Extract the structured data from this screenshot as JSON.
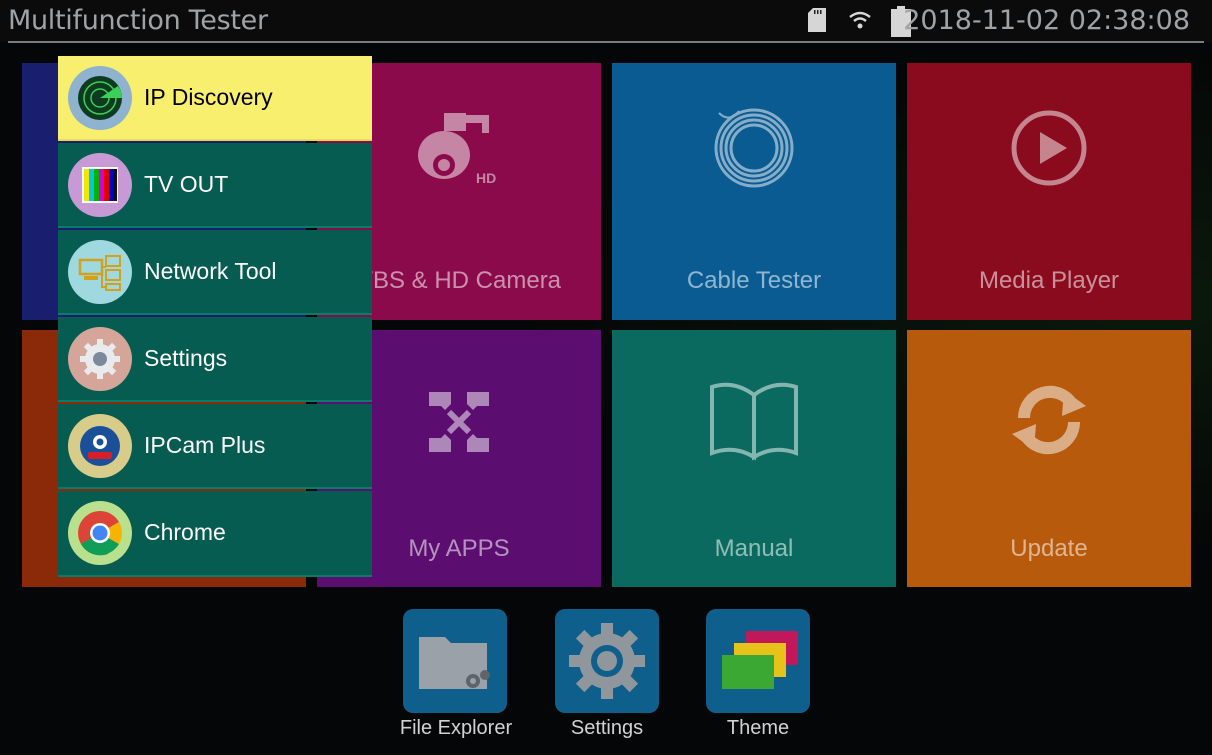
{
  "status_bar": {
    "title": "Multifunction Tester",
    "datetime": "2018-11-02 02:38:08",
    "icons": [
      "sd-card-icon",
      "wifi-icon",
      "battery-icon"
    ]
  },
  "tiles": [
    {
      "name": "cvbs-hd-camera",
      "label": "CVBS & HD Camera",
      "visible_label": "VBS & HD Camera",
      "color": "#8b0a4b",
      "icon": "ptz-camera-icon",
      "badge": "HD"
    },
    {
      "name": "cable-tester",
      "label": "Cable Tester",
      "color": "#0a5b92",
      "icon": "cable-coil-icon"
    },
    {
      "name": "media-player",
      "label": "Media Player",
      "color": "#8a0a1e",
      "icon": "play-icon"
    },
    {
      "name": "my-apps",
      "label": "My APPS",
      "color": "#5b0e70",
      "icon": "apps-icon"
    },
    {
      "name": "manual",
      "label": "Manual",
      "color": "#0a6a5f",
      "icon": "book-icon"
    },
    {
      "name": "update",
      "label": "Update",
      "color": "#b85a0c",
      "icon": "refresh-icon"
    }
  ],
  "dock": [
    {
      "label": "File Explorer",
      "icon": "folder-gear-icon"
    },
    {
      "label": "Settings",
      "icon": "gear-icon"
    },
    {
      "label": "Theme",
      "icon": "theme-cards-icon"
    }
  ],
  "menu": {
    "items": [
      {
        "label": "IP Discovery",
        "icon": "radar-icon",
        "selected": true
      },
      {
        "label": "TV OUT",
        "icon": "color-bars-icon",
        "selected": false
      },
      {
        "label": "Network Tool",
        "icon": "network-icon",
        "selected": false
      },
      {
        "label": "Settings",
        "icon": "gear-icon",
        "selected": false
      },
      {
        "label": "IPCam Plus",
        "icon": "abus-camera-icon",
        "selected": false
      },
      {
        "label": "Chrome",
        "icon": "chrome-icon",
        "selected": false
      }
    ]
  },
  "colors": {
    "menu_bg": "#065c50",
    "menu_selected": "#f8ef6f",
    "dock_button": "#0e5f8c"
  }
}
